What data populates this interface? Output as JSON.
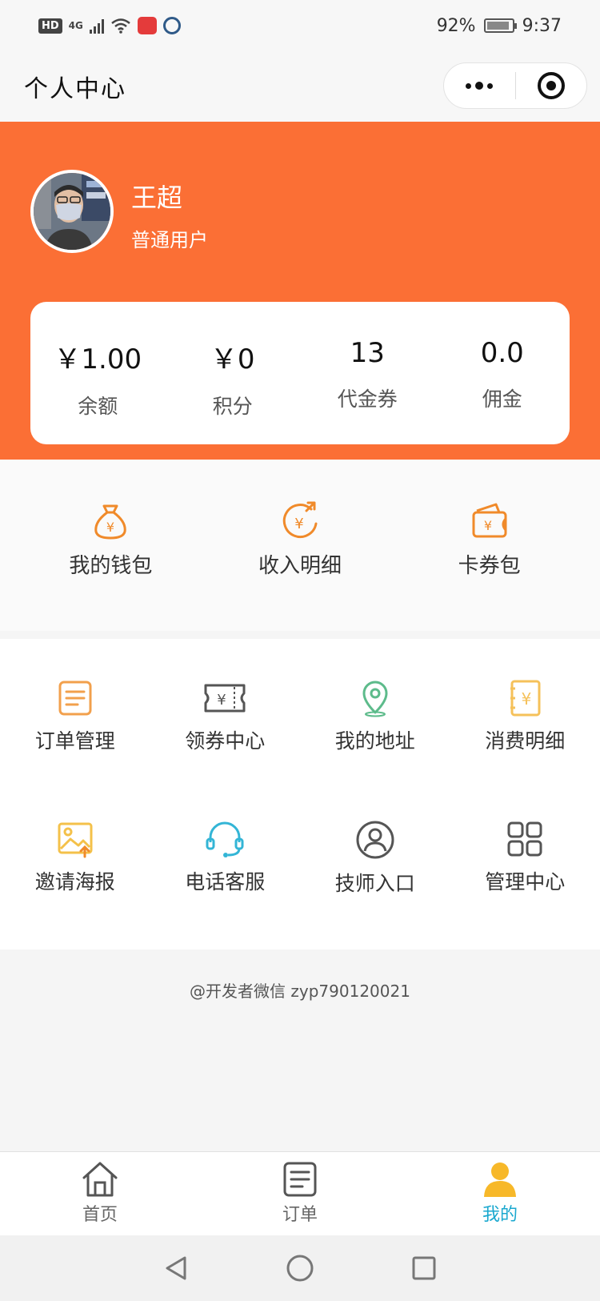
{
  "status_bar": {
    "hd_badge": "HD",
    "network": "4G",
    "battery_percent": "92%",
    "battery_level": 0.92,
    "time": "9:37"
  },
  "nav": {
    "title": "个人中心"
  },
  "profile": {
    "name": "王超",
    "level": "普通用户"
  },
  "stats": [
    {
      "value": "￥1.00",
      "label": "余额"
    },
    {
      "value": "￥0",
      "label": "积分"
    },
    {
      "value": "13",
      "label": "代金券"
    },
    {
      "value": "0.0",
      "label": "佣金"
    }
  ],
  "wallet": [
    {
      "label": "我的钱包",
      "icon": "money-bag-icon"
    },
    {
      "label": "收入明细",
      "icon": "income-icon"
    },
    {
      "label": "卡券包",
      "icon": "card-wallet-icon"
    }
  ],
  "grid": [
    {
      "label": "订单管理",
      "icon": "order-list-icon",
      "color": "#f2a04c"
    },
    {
      "label": "领券中心",
      "icon": "coupon-icon",
      "color": "#555555"
    },
    {
      "label": "我的地址",
      "icon": "location-pin-icon",
      "color": "#5dbb8b"
    },
    {
      "label": "消费明细",
      "icon": "receipt-icon",
      "color": "#f5c15a"
    },
    {
      "label": "邀请海报",
      "icon": "poster-image-icon",
      "color": "#f4c14a"
    },
    {
      "label": "电话客服",
      "icon": "headset-icon",
      "color": "#33b5d6"
    },
    {
      "label": "技师入口",
      "icon": "user-circle-icon",
      "color": "#555555"
    },
    {
      "label": "管理中心",
      "icon": "grid-apps-icon",
      "color": "#555555"
    }
  ],
  "footer_note": "@开发者微信 zyp790120021",
  "tabs": [
    {
      "label": "首页",
      "icon": "home-icon"
    },
    {
      "label": "订单",
      "icon": "order-icon"
    },
    {
      "label": "我的",
      "icon": "user-icon",
      "active": true
    }
  ],
  "colors": {
    "brand_orange": "#fb6f35",
    "icon_orange": "#f08a2a",
    "active_tab": "#1aa8cf",
    "active_tab_icon": "#f7b829"
  }
}
